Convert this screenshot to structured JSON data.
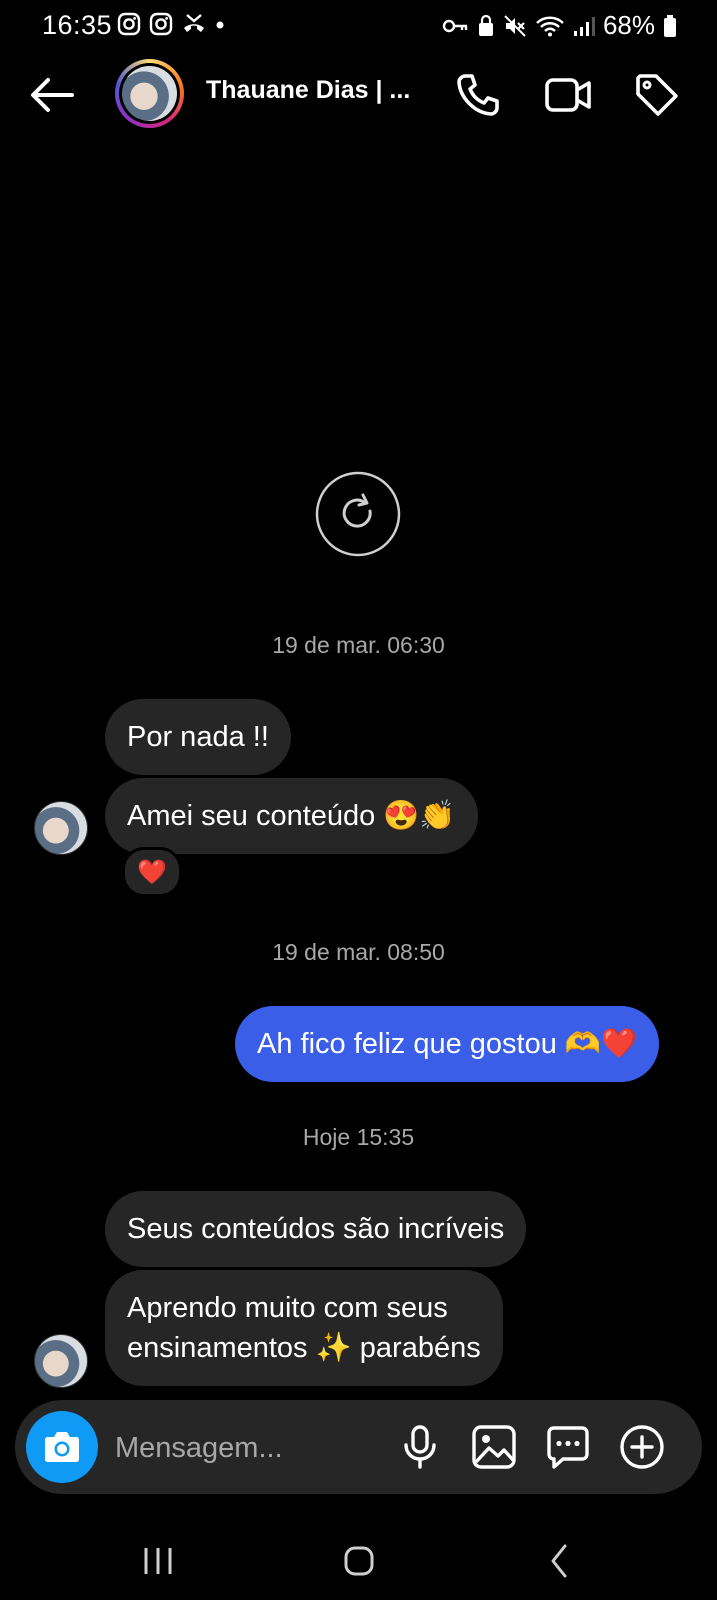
{
  "status_bar": {
    "time": "16:35",
    "battery": "68%",
    "left_icons": [
      "instagram-icon",
      "instagram-icon",
      "missed-call-icon",
      "dot-icon"
    ],
    "right_icons": [
      "key-icon",
      "lock-icon",
      "mute-icon",
      "wifi-icon",
      "signal-icon",
      "battery-icon"
    ]
  },
  "header": {
    "contact_name": "Thauane Dias | ...",
    "icons": [
      "back-arrow-icon",
      "phone-icon",
      "video-icon",
      "tag-icon"
    ]
  },
  "conversation": {
    "groups": [
      {
        "timestamp": "19 de mar. 06:30",
        "messages": [
          {
            "direction": "in",
            "text": "Por nada !!"
          },
          {
            "direction": "in",
            "text": "Amei seu conteúdo 😍👏",
            "reaction": "❤️"
          }
        ]
      },
      {
        "timestamp": "19 de mar. 08:50",
        "messages": [
          {
            "direction": "out",
            "text": "Ah fico feliz que gostou 🫶❤️"
          }
        ]
      },
      {
        "timestamp": "Hoje 15:35",
        "messages": [
          {
            "direction": "in",
            "text": "Seus conteúdos são incríveis"
          },
          {
            "direction": "in",
            "lines": [
              "Aprendo muito com seus",
              "ensinamentos ✨ parabéns"
            ]
          }
        ]
      }
    ]
  },
  "composer": {
    "placeholder": "Mensagem...",
    "icons": [
      "camera-icon",
      "microphone-icon",
      "gallery-icon",
      "sticker-icon",
      "plus-icon"
    ],
    "camera_color": "#0f9af5"
  },
  "colors": {
    "outgoing_bubble": "#3a5ee8",
    "incoming_bubble": "#262626",
    "background": "#000000"
  }
}
